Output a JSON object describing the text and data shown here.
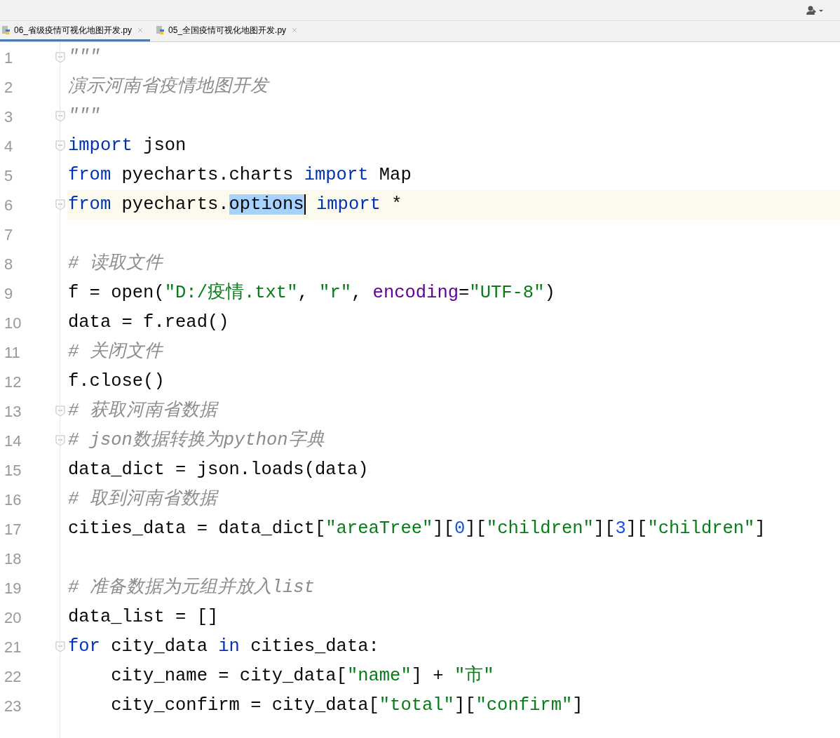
{
  "tabs": [
    {
      "label": "06_省级疫情可视化地图开发.py",
      "selected": true
    },
    {
      "label": "05_全国疫情可视化地图开发.py",
      "selected": false
    }
  ],
  "lines": [
    {
      "number": "1",
      "fold": true,
      "current": false,
      "tokens": [
        {
          "text": "\"\"\"",
          "kind": "docstring"
        }
      ]
    },
    {
      "number": "2",
      "fold": false,
      "current": false,
      "tokens": [
        {
          "text": "演示河南省疫情地图开发",
          "kind": "docstring"
        }
      ]
    },
    {
      "number": "3",
      "fold": true,
      "current": false,
      "tokens": [
        {
          "text": "\"\"\"",
          "kind": "docstring"
        }
      ]
    },
    {
      "number": "4",
      "fold": true,
      "current": false,
      "tokens": [
        {
          "text": "import",
          "kind": "keyword"
        },
        {
          "text": " json",
          "kind": "plain"
        }
      ]
    },
    {
      "number": "5",
      "fold": false,
      "current": false,
      "tokens": [
        {
          "text": "from",
          "kind": "keyword"
        },
        {
          "text": " pyecharts.charts ",
          "kind": "plain"
        },
        {
          "text": "import",
          "kind": "keyword"
        },
        {
          "text": " Map",
          "kind": "plain"
        }
      ]
    },
    {
      "number": "6",
      "fold": true,
      "current": true,
      "tokens": [
        {
          "text": "from",
          "kind": "keyword"
        },
        {
          "text": " pyecharts.",
          "kind": "plain"
        },
        {
          "text": "options",
          "kind": "selected"
        },
        {
          "text": " import",
          "kind": "keyword"
        },
        {
          "text": " *",
          "kind": "plain"
        }
      ]
    },
    {
      "number": "7",
      "fold": false,
      "current": false
    },
    {
      "number": "8",
      "fold": false,
      "current": false,
      "tokens": [
        {
          "text": "# 读取文件",
          "kind": "comment"
        }
      ]
    },
    {
      "number": "9",
      "fold": false,
      "current": false,
      "tokens": [
        {
          "text": "f = open(",
          "kind": "plain"
        },
        {
          "text": "\"D:/疫情.txt\"",
          "kind": "string"
        },
        {
          "text": ", ",
          "kind": "plain"
        },
        {
          "text": "\"r\"",
          "kind": "string"
        },
        {
          "text": ", ",
          "kind": "plain"
        },
        {
          "text": "encoding",
          "kind": "param"
        },
        {
          "text": "=",
          "kind": "plain"
        },
        {
          "text": "\"UTF-8\"",
          "kind": "string"
        },
        {
          "text": ")",
          "kind": "plain"
        }
      ]
    },
    {
      "number": "10",
      "fold": false,
      "current": false,
      "tokens": [
        {
          "text": "data = f.read()",
          "kind": "plain"
        }
      ]
    },
    {
      "number": "11",
      "fold": false,
      "current": false,
      "tokens": [
        {
          "text": "# 关闭文件",
          "kind": "comment"
        }
      ]
    },
    {
      "number": "12",
      "fold": false,
      "current": false,
      "tokens": [
        {
          "text": "f.close()",
          "kind": "plain"
        }
      ]
    },
    {
      "number": "13",
      "fold": true,
      "current": false,
      "tokens": [
        {
          "text": "# 获取河南省数据",
          "kind": "comment"
        }
      ]
    },
    {
      "number": "14",
      "fold": true,
      "current": false,
      "tokens": [
        {
          "text": "# json数据转换为python字典",
          "kind": "comment"
        }
      ]
    },
    {
      "number": "15",
      "fold": false,
      "current": false,
      "tokens": [
        {
          "text": "data_dict = json.loads(data)",
          "kind": "plain"
        }
      ]
    },
    {
      "number": "16",
      "fold": false,
      "current": false,
      "tokens": [
        {
          "text": "# 取到河南省数据",
          "kind": "comment"
        }
      ]
    },
    {
      "number": "17",
      "fold": false,
      "current": false,
      "tokens": [
        {
          "text": "cities_data = data_dict[",
          "kind": "plain"
        },
        {
          "text": "\"areaTree\"",
          "kind": "string"
        },
        {
          "text": "][",
          "kind": "plain"
        },
        {
          "text": "0",
          "kind": "number"
        },
        {
          "text": "][",
          "kind": "plain"
        },
        {
          "text": "\"children\"",
          "kind": "string"
        },
        {
          "text": "][",
          "kind": "plain"
        },
        {
          "text": "3",
          "kind": "number"
        },
        {
          "text": "][",
          "kind": "plain"
        },
        {
          "text": "\"children\"",
          "kind": "string"
        },
        {
          "text": "]",
          "kind": "plain"
        }
      ]
    },
    {
      "number": "18",
      "fold": false,
      "current": false
    },
    {
      "number": "19",
      "fold": false,
      "current": false,
      "tokens": [
        {
          "text": "# 准备数据为元组并放入list",
          "kind": "comment"
        }
      ]
    },
    {
      "number": "20",
      "fold": false,
      "current": false,
      "tokens": [
        {
          "text": "data_list = []",
          "kind": "plain"
        }
      ]
    },
    {
      "number": "21",
      "fold": true,
      "current": false,
      "tokens": [
        {
          "text": "for",
          "kind": "keyword"
        },
        {
          "text": " city_data ",
          "kind": "plain"
        },
        {
          "text": "in",
          "kind": "keyword"
        },
        {
          "text": " cities_data:",
          "kind": "plain"
        }
      ]
    },
    {
      "number": "22",
      "fold": false,
      "current": false,
      "tokens": [
        {
          "text": "    city_name = city_data[",
          "kind": "plain"
        },
        {
          "text": "\"name\"",
          "kind": "string"
        },
        {
          "text": "] + ",
          "kind": "plain"
        },
        {
          "text": "\"市\"",
          "kind": "string"
        }
      ]
    },
    {
      "number": "23",
      "fold": false,
      "current": false,
      "tokens": [
        {
          "text": "    city_confirm = city_data[",
          "kind": "plain"
        },
        {
          "text": "\"total\"",
          "kind": "string"
        },
        {
          "text": "][",
          "kind": "plain"
        },
        {
          "text": "\"confirm\"",
          "kind": "string"
        },
        {
          "text": "]",
          "kind": "plain"
        }
      ]
    }
  ]
}
